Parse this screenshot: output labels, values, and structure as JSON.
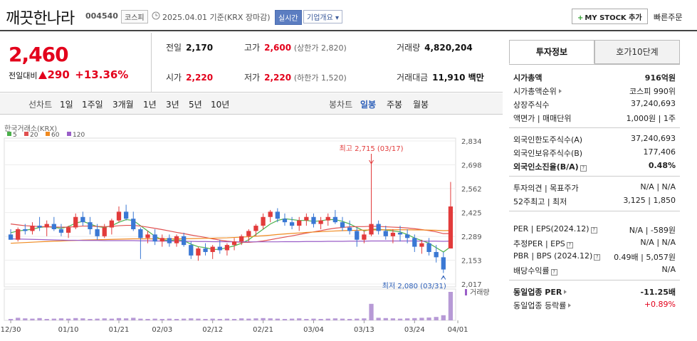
{
  "header": {
    "name": "깨끗한나라",
    "code": "004540",
    "market": "코스피",
    "date": "2025.04.01 기준(KRX 장마감)",
    "realtime": "실시간",
    "company_btn": "기업개요",
    "mystock": "MY STOCK 추가",
    "quick_order": "빠른주문"
  },
  "price": {
    "current": "2,460",
    "change_label": "전일대비",
    "change_value": "290",
    "change_pct": "+13.36%"
  },
  "quote": {
    "prev_label": "전일",
    "prev": "2,170",
    "high_label": "고가",
    "high": "2,600",
    "upper_limit": "(상한가 2,820)",
    "volume_label": "거래량",
    "volume": "4,820,204",
    "open_label": "시가",
    "open": "2,220",
    "low_label": "저가",
    "low": "2,220",
    "lower_limit": "(하한가 1,520)",
    "amount_label": "거래대금",
    "amount": "11,910 백만"
  },
  "periods": {
    "line_chart": "선차트",
    "items": [
      "1일",
      "1주일",
      "3개월",
      "1년",
      "3년",
      "5년",
      "10년"
    ],
    "candle_chart": "봉차트",
    "candle_items": [
      "일봉",
      "주봉",
      "월봉"
    ]
  },
  "chart_data": {
    "type": "candlestick",
    "source": "한국거래소(KRX)",
    "legend": [
      {
        "name": "5",
        "color": "#4bb04b"
      },
      {
        "name": "20",
        "color": "#e05050"
      },
      {
        "name": "60",
        "color": "#f08a20"
      },
      {
        "name": "120",
        "color": "#9a5ec8"
      }
    ],
    "y_ticks": [
      "2,834",
      "2,698",
      "2,562",
      "2,425",
      "2,289",
      "2,153",
      "2,017"
    ],
    "y_tick_values": [
      2834,
      2698,
      2562,
      2425,
      2289,
      2153,
      2017
    ],
    "ylim": [
      2017,
      2834
    ],
    "x_ticks": [
      "12/30",
      "01/10",
      "01/21",
      "02/03",
      "02/12",
      "02/21",
      "03/04",
      "03/13",
      "03/24",
      "04/01"
    ],
    "x_tick_index": [
      0,
      8,
      15,
      21,
      28,
      35,
      42,
      49,
      56,
      62
    ],
    "annotation_high": "최고 2,715 (03/17)",
    "annotation_low": "최저 2,080 (03/31)",
    "volume_label": "거래량",
    "candles": [
      [
        2300,
        2330,
        2270,
        2270
      ],
      [
        2270,
        2340,
        2260,
        2330
      ],
      [
        2330,
        2360,
        2300,
        2320
      ],
      [
        2320,
        2370,
        2300,
        2350
      ],
      [
        2350,
        2400,
        2320,
        2340
      ],
      [
        2340,
        2380,
        2290,
        2360
      ],
      [
        2360,
        2400,
        2320,
        2330
      ],
      [
        2330,
        2360,
        2290,
        2310
      ],
      [
        2310,
        2350,
        2280,
        2340
      ],
      [
        2340,
        2420,
        2330,
        2400
      ],
      [
        2400,
        2430,
        2350,
        2370
      ],
      [
        2370,
        2400,
        2300,
        2330
      ],
      [
        2330,
        2360,
        2270,
        2290
      ],
      [
        2290,
        2360,
        2280,
        2340
      ],
      [
        2340,
        2390,
        2300,
        2380
      ],
      [
        2380,
        2460,
        2370,
        2430
      ],
      [
        2430,
        2470,
        2380,
        2390
      ],
      [
        2390,
        2430,
        2320,
        2330
      ],
      [
        2330,
        2340,
        2160,
        2280
      ],
      [
        2280,
        2320,
        2250,
        2300
      ],
      [
        2300,
        2330,
        2240,
        2260
      ],
      [
        2260,
        2300,
        2230,
        2280
      ],
      [
        2280,
        2300,
        2230,
        2250
      ],
      [
        2250,
        2300,
        2230,
        2290
      ],
      [
        2290,
        2310,
        2230,
        2240
      ],
      [
        2240,
        2260,
        2160,
        2180
      ],
      [
        2180,
        2230,
        2150,
        2220
      ],
      [
        2220,
        2250,
        2180,
        2200
      ],
      [
        2200,
        2240,
        2160,
        2230
      ],
      [
        2230,
        2270,
        2190,
        2210
      ],
      [
        2210,
        2250,
        2180,
        2240
      ],
      [
        2240,
        2280,
        2210,
        2260
      ],
      [
        2260,
        2300,
        2240,
        2290
      ],
      [
        2290,
        2330,
        2260,
        2320
      ],
      [
        2320,
        2360,
        2290,
        2350
      ],
      [
        2350,
        2420,
        2330,
        2400
      ],
      [
        2400,
        2440,
        2370,
        2430
      ],
      [
        2430,
        2450,
        2370,
        2390
      ],
      [
        2390,
        2420,
        2350,
        2370
      ],
      [
        2370,
        2400,
        2330,
        2350
      ],
      [
        2350,
        2400,
        2320,
        2380
      ],
      [
        2380,
        2420,
        2350,
        2400
      ],
      [
        2400,
        2420,
        2340,
        2360
      ],
      [
        2360,
        2400,
        2330,
        2380
      ],
      [
        2380,
        2420,
        2350,
        2400
      ],
      [
        2400,
        2440,
        2360,
        2370
      ],
      [
        2370,
        2400,
        2320,
        2340
      ],
      [
        2340,
        2380,
        2300,
        2320
      ],
      [
        2320,
        2340,
        2230,
        2270
      ],
      [
        2270,
        2320,
        2250,
        2300
      ],
      [
        2300,
        2715,
        2290,
        2360
      ],
      [
        2360,
        2380,
        2300,
        2320
      ],
      [
        2320,
        2350,
        2270,
        2290
      ],
      [
        2290,
        2330,
        2250,
        2310
      ],
      [
        2310,
        2350,
        2260,
        2300
      ],
      [
        2300,
        2330,
        2250,
        2280
      ],
      [
        2280,
        2300,
        2200,
        2230
      ],
      [
        2230,
        2270,
        2190,
        2250
      ],
      [
        2250,
        2280,
        2180,
        2200
      ],
      [
        2200,
        2240,
        2140,
        2170
      ],
      [
        2170,
        2200,
        2080,
        2100
      ],
      [
        2220,
        2600,
        2220,
        2460
      ]
    ],
    "volumes": [
      5,
      9,
      7,
      6,
      8,
      5,
      6,
      7,
      6,
      8,
      7,
      5,
      6,
      7,
      6,
      8,
      7,
      9,
      6,
      5,
      6,
      5,
      6,
      5,
      6,
      7,
      6,
      5,
      6,
      5,
      6,
      5,
      7,
      6,
      7,
      8,
      7,
      6,
      5,
      6,
      7,
      5,
      6,
      5,
      6,
      7,
      6,
      5,
      6,
      7,
      58,
      9,
      8,
      7,
      6,
      7,
      8,
      9,
      10,
      12,
      18,
      100
    ],
    "ma": {
      "ma5": [
        2310,
        2320,
        2325,
        2330,
        2340,
        2345,
        2340,
        2335,
        2345,
        2365,
        2375,
        2360,
        2345,
        2340,
        2350,
        2370,
        2385,
        2380,
        2350,
        2320,
        2290,
        2270,
        2265,
        2270,
        2265,
        2245,
        2230,
        2225,
        2215,
        2215,
        2225,
        2235,
        2250,
        2270,
        2300,
        2330,
        2360,
        2380,
        2390,
        2385,
        2380,
        2380,
        2375,
        2378,
        2385,
        2385,
        2375,
        2360,
        2340,
        2320,
        2330,
        2330,
        2325,
        2320,
        2315,
        2300,
        2280,
        2265,
        2250,
        2225,
        2200,
        2230
      ],
      "ma20": [
        2360,
        2355,
        2350,
        2348,
        2345,
        2345,
        2343,
        2342,
        2342,
        2345,
        2348,
        2348,
        2346,
        2345,
        2346,
        2350,
        2352,
        2352,
        2348,
        2342,
        2335,
        2328,
        2320,
        2312,
        2305,
        2297,
        2290,
        2283,
        2275,
        2268,
        2262,
        2258,
        2255,
        2255,
        2258,
        2263,
        2270,
        2278,
        2285,
        2292,
        2300,
        2308,
        2315,
        2322,
        2330,
        2336,
        2340,
        2344,
        2345,
        2345,
        2347,
        2346,
        2344,
        2342,
        2340,
        2337,
        2333,
        2328,
        2322,
        2315,
        2305,
        2305
      ],
      "ma60": [
        2250,
        2252,
        2254,
        2256,
        2258,
        2260,
        2262,
        2263,
        2265,
        2266,
        2268,
        2269,
        2270,
        2271,
        2272,
        2273,
        2274,
        2275,
        2275,
        2275,
        2275,
        2275,
        2275,
        2275,
        2276,
        2276,
        2277,
        2278,
        2279,
        2280,
        2281,
        2283,
        2285,
        2287,
        2290,
        2293,
        2296,
        2300,
        2303,
        2306,
        2309,
        2312,
        2314,
        2316,
        2318,
        2320,
        2322,
        2323,
        2324,
        2325,
        2326,
        2326,
        2327,
        2327,
        2327,
        2327,
        2326,
        2326,
        2325,
        2324,
        2322,
        2323
      ],
      "ma120": [
        2275,
        2274,
        2273,
        2272,
        2271,
        2270,
        2269,
        2268,
        2267,
        2267,
        2266,
        2266,
        2266,
        2265,
        2265,
        2265,
        2265,
        2265,
        2264,
        2264,
        2263,
        2263,
        2262,
        2262,
        2261,
        2261,
        2260,
        2260,
        2259,
        2259,
        2258,
        2258,
        2258,
        2258,
        2258,
        2258,
        2258,
        2258,
        2259,
        2259,
        2259,
        2260,
        2260,
        2260,
        2261,
        2261,
        2261,
        2262,
        2262,
        2262,
        2263,
        2263,
        2263,
        2263,
        2263,
        2263,
        2263,
        2262,
        2262,
        2262,
        2261,
        2262
      ]
    }
  },
  "side": {
    "tab_active": "투자정보",
    "tab_inactive": "호가10단계",
    "rows": {
      "mcap_label": "시가총액",
      "mcap": "916억원",
      "mcap_rank_label": "시가총액순위",
      "mcap_rank": "코스피 990위",
      "shares_label": "상장주식수",
      "shares": "37,240,693",
      "face_label": "액면가 | 매매단위",
      "face": "1,000원 | 1주",
      "foreign_limit_label": "외국인한도주식수(A)",
      "foreign_limit": "37,240,693",
      "foreign_hold_label": "외국인보유주식수(B)",
      "foreign_hold": "177,406",
      "foreign_ratio_label": "외국인소진율(B/A)",
      "foreign_ratio": "0.48%",
      "opinion_label": "투자의견 | 목표주가",
      "opinion": "N/A | N/A",
      "w52_label": "52주최고 | 최저",
      "w52": "3,125 | 1,850",
      "per_label": "PER | EPS(2024.12)",
      "per": "N/A | -589원",
      "est_per_label": "추정PER | EPS",
      "est_per": "N/A | N/A",
      "pbr_label": "PBR | BPS (2024.12)",
      "pbr": "0.49배 | 5,057원",
      "div_label": "배당수익률",
      "div": "N/A",
      "ind_per_label": "동일업종 PER",
      "ind_per": "-11.25배",
      "ind_rate_label": "동일업종 등락률",
      "ind_rate": "+0.89%"
    }
  }
}
